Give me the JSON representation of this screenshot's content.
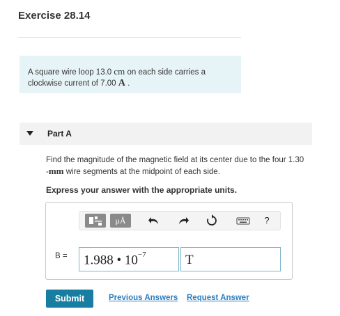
{
  "exercise": {
    "title": "Exercise 28.14"
  },
  "problem": {
    "text_before": "A square wire loop 13.0 ",
    "unit1": "cm",
    "text_mid": " on each side carries a clockwise current of 7.00 ",
    "unit2": "A",
    "text_end": " ."
  },
  "part": {
    "label": "Part A"
  },
  "question": {
    "text_before": "Find the magnitude of the magnetic field at its center due to the four 1.30 -",
    "unit": "mm",
    "text_after": " wire segments at the midpoint of each side."
  },
  "instruction": "Express your answer with the appropriate units.",
  "toolbar": {
    "units_label": "μÅ",
    "undo_icon": "undo-arrow-icon",
    "redo_icon": "redo-arrow-icon",
    "reset_icon": "reset-icon",
    "keyboard_icon": "keyboard-icon",
    "help_label": "?"
  },
  "answer": {
    "variable_label": "B =",
    "value_mantissa": "1.988 • 10",
    "value_exponent": "−7",
    "unit_value": "T"
  },
  "actions": {
    "submit_label": "Submit",
    "previous_answers_label": "Previous Answers",
    "request_answer_label": "Request Answer"
  },
  "colors": {
    "problem_bg": "#e6f4f7",
    "submit_bg": "#187ea1",
    "link": "#2b7dc0",
    "field_border": "#78b6c9"
  }
}
